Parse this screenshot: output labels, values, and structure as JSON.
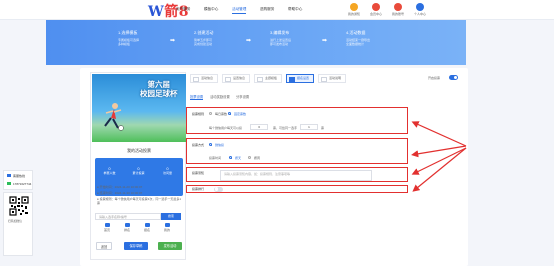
{
  "logo": {
    "main": "W",
    "sub": "箭8"
  },
  "nav": {
    "items": [
      "用户服务",
      "模板中心",
      "活动管理",
      "选购服务",
      "帮助中心"
    ]
  },
  "user_icons": [
    {
      "label": "我的通知",
      "color": "#f5a623"
    },
    {
      "label": "会员中心",
      "color": "#e94b3b"
    },
    {
      "label": "我的账号",
      "color": "#e94b3b"
    },
    {
      "label": "个人中心",
      "color": "#2b6fe0"
    }
  ],
  "banner": {
    "steps": [
      {
        "title": "1.选择模板",
        "desc": "专属模板可选择\n多种模板"
      },
      {
        "title": "2.创建活动",
        "desc": "简单五步即可\n完成创建活动"
      },
      {
        "title": "3.编辑发布",
        "desc": "进行上述设置后\n即可发布活动"
      },
      {
        "title": "4.活动数据",
        "desc": "活动结束一键导出\n全面数据统计"
      }
    ]
  },
  "phone": {
    "poster_title": "第六届\n校园足球杯",
    "register_title": "我的活动投票",
    "stats": [
      {
        "value": "0",
        "label": "参赛人数"
      },
      {
        "value": "0",
        "label": "累计投票"
      },
      {
        "value": "0",
        "label": "访问量"
      }
    ],
    "info_lines": [
      "● 开始时间：2024-11-20 10:00:07",
      "● 结束时间：2024-11-30 10:00:07",
      "● 投票规则：每个微信用户每天可投票3次，同一选手一天最多1票"
    ],
    "search_placeholder": "请输入选手名称/编号",
    "search_button": "搜索",
    "bottom_nav": [
      "首页",
      "排名",
      "报名",
      "我的"
    ],
    "buttons": [
      "返回",
      "保存草稿",
      "发布活动"
    ]
  },
  "tpl_tabs": [
    "活动信息",
    "设置信息",
    "主题模板",
    "报名设置",
    "活动说明"
  ],
  "switch_label": "开启投票",
  "subtabs": [
    "投票设置",
    "活动奖励设置",
    "分享设置"
  ],
  "form": {
    "vote_rule": {
      "label": "投票规则",
      "options": [
        "每日票数",
        "固定票数"
      ],
      "desc_prefix": "每个微信用户每天可以投",
      "votes": "3",
      "desc_mid": "票，可给同一选手",
      "per_player": "1",
      "desc_suffix": "票"
    },
    "vote_method": {
      "label": "投票方式",
      "option": "微信投",
      "time_label": "投票时间",
      "time_options": [
        "按天",
        "按周"
      ]
    },
    "vote_notice": {
      "label": "投票须知",
      "placeholder": "请输入投票须知内容，如：投票规则、注意事项等"
    },
    "vote_queue": {
      "label": "投票排行",
      "toggle_on": false
    }
  },
  "side_panel": {
    "contact_label": "客服热线",
    "phone": "17871627744",
    "qr_caption": "扫码加微信"
  },
  "colors": {
    "primary": "#2b6fe0",
    "red": "#e2302f",
    "banner": "#5b9af2"
  }
}
